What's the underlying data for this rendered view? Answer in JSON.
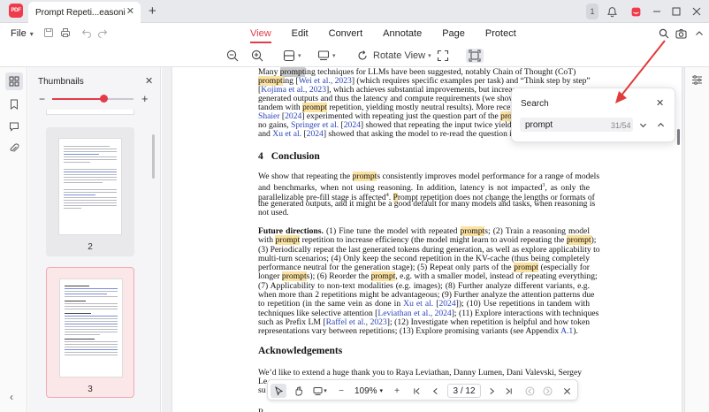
{
  "titlebar": {
    "logo_text": "PDF",
    "tab_title": "Prompt Repeti...easoning LLMs",
    "notif_count": "1"
  },
  "menu": {
    "file_label": "File",
    "tabs": [
      "View",
      "Edit",
      "Convert",
      "Annotate",
      "Page",
      "Protect"
    ],
    "active_tab": "View"
  },
  "toolbar": {
    "rotate_label": "Rotate View"
  },
  "thumbnails": {
    "title": "Thumbnails",
    "zoom_level": 0.63,
    "pages": [
      {
        "number": "2",
        "selected": false
      },
      {
        "number": "3",
        "selected": true
      }
    ]
  },
  "document": {
    "lines_top": [
      [
        [
          "Many ",
          ""
        ],
        [
          "prompt",
          "cur"
        ],
        [
          "ing techniques for LLMs have been suggested, notably Chain of Thought (CoT)",
          ""
        ]
      ],
      [
        [
          "prompt",
          "hl"
        ],
        [
          "ing [",
          ""
        ],
        [
          "Wei et al., 2023",
          "cite"
        ],
        [
          "] (which requires specific examples per task) and “Think step by step”",
          ""
        ]
      ],
      [
        [
          "[",
          ""
        ],
        [
          "Kojima et al., 2023",
          "cite"
        ],
        [
          "], which achieves substantial improvements, but increas",
          ""
        ]
      ],
      [
        [
          "generated outputs and thus the latency and compute requirements (we show t",
          ""
        ]
      ],
      [
        [
          "tandem with ",
          ""
        ],
        [
          "prompt",
          "hl"
        ],
        [
          " repetition, yielding mostly neutral results). More recentl",
          ""
        ]
      ],
      [
        [
          "Shaier",
          "cite"
        ],
        [
          " [",
          ""
        ],
        [
          "2024",
          "cite"
        ],
        [
          "] experimented with repeating just the question part of the ",
          ""
        ],
        [
          "prompt",
          "hl"
        ],
        [
          " a",
          ""
        ]
      ],
      [
        [
          "no gains, ",
          ""
        ],
        [
          "Springer et al.",
          "cite"
        ],
        [
          " [",
          ""
        ],
        [
          "2024",
          "cite"
        ],
        [
          "] showed that repeating the input twice yields be",
          ""
        ]
      ],
      [
        [
          "and ",
          ""
        ],
        [
          "Xu et al.",
          "cite"
        ],
        [
          " [",
          ""
        ],
        [
          "2024",
          "cite"
        ],
        [
          "] showed that asking the model to re-read the question impr",
          ""
        ]
      ]
    ],
    "conclusion_num": "4",
    "conclusion_title": "Conclusion",
    "lines_conclusion": [
      [
        [
          "We show that repeating the ",
          ""
        ],
        [
          "prompt",
          "hl"
        ],
        [
          "s consistently improves model performance for a range of models",
          ""
        ]
      ],
      [
        [
          "and benchmarks, when not using reasoning.  In addition, latency is not impacted",
          ""
        ],
        [
          "3",
          "sup"
        ],
        [
          ", as only the",
          ""
        ]
      ],
      [
        [
          "parallelizable pre-fill stage is affected",
          ""
        ],
        [
          "4",
          "sup"
        ],
        [
          ". ",
          ""
        ],
        [
          "P",
          "hl"
        ],
        [
          "rompt repetition does not change the lengths or formats of",
          ""
        ]
      ],
      [
        [
          "the generated outputs, and it might be a good default for many models and tasks, when reasoning is",
          ""
        ]
      ],
      [
        [
          "not used.",
          ""
        ]
      ]
    ],
    "future_label": "Future directions.",
    "lines_future": [
      [
        [
          "",
          ""
        ],
        [
          "    (1) Fine tune the model with repeated ",
          ""
        ],
        [
          "prompt",
          "hl"
        ],
        [
          "s; (2) Train a reasoning model",
          ""
        ]
      ],
      [
        [
          "with ",
          ""
        ],
        [
          "prompt",
          "hl"
        ],
        [
          " repetition to increase efficiency (the model might learn to avoid repeating the ",
          ""
        ],
        [
          "prompt",
          "hl"
        ],
        [
          ");",
          ""
        ]
      ],
      [
        [
          "(3) Periodically repeat the last generated tokens during generation, as well as explore applicability to",
          ""
        ]
      ],
      [
        [
          "multi-turn scenarios; (4) Only keep the second repetition in the KV-cache (thus being completely",
          ""
        ]
      ],
      [
        [
          "performance neutral for the generation stage); (5) Repeat only parts of the ",
          ""
        ],
        [
          "prompt",
          "hl"
        ],
        [
          " (especially for",
          ""
        ]
      ],
      [
        [
          "longer ",
          ""
        ],
        [
          "prompt",
          "hl"
        ],
        [
          "s); (6) Reorder the ",
          ""
        ],
        [
          "prompt",
          "hl"
        ],
        [
          ", e.g. with a smaller model, instead of repeating everything;",
          ""
        ]
      ],
      [
        [
          "(7) Applicability to non-text modalities (e.g.  images); (8) Further analyze different variants, e.g.",
          ""
        ]
      ],
      [
        [
          "when more than 2 repetitions might be advantageous; (9) Further analyze the attention patterns due",
          ""
        ]
      ],
      [
        [
          "to repetition (in the same vein as done in ",
          ""
        ],
        [
          "Xu et al.",
          "cite"
        ],
        [
          " [",
          ""
        ],
        [
          "2024",
          "cite"
        ],
        [
          "]); (10) Use repetitions in tandem with",
          ""
        ]
      ],
      [
        [
          "techniques like selective attention [",
          ""
        ],
        [
          "Leviathan et al., 2024",
          "cite"
        ],
        [
          "]; (11) Explore interactions with techniques",
          ""
        ]
      ],
      [
        [
          "such as Prefix LM [",
          ""
        ],
        [
          "Raffel et al., 2023",
          "cite"
        ],
        [
          "]; (12) Investigate when repetition is helpful and how token",
          ""
        ]
      ],
      [
        [
          "representations vary between repetitions; (13) Explore promising variants (see Appendix ",
          ""
        ],
        [
          "A.1",
          "cite"
        ],
        [
          ").",
          ""
        ]
      ]
    ],
    "ack_title": "Acknowledgements",
    "lines_ack": [
      [
        [
          "We’d like to extend a huge thank you to Raya Leviathan, Danny Lumen, Dani Valevski, Sergey",
          ""
        ]
      ],
      [
        [
          "Le",
          ""
        ]
      ],
      [
        [
          "su",
          ""
        ]
      ]
    ],
    "footnote_fragment": "R"
  },
  "bottom_bar": {
    "zoom": "109%",
    "current_page": "3",
    "total_pages": "12",
    "page_display": "3 / 12"
  },
  "search": {
    "title": "Search",
    "query": "prompt",
    "count": "31/54"
  },
  "colors": {
    "accent": "#e23b4a",
    "highlight": "#fbe2a2",
    "current_match": "#c9c9c9",
    "citation": "#2a44b8"
  },
  "icons": {
    "save": "save-icon",
    "print": "print-icon",
    "undo": "undo-icon",
    "redo": "redo-icon",
    "search": "search-icon",
    "camera": "camera-icon",
    "expand": "chevron-up-icon"
  }
}
